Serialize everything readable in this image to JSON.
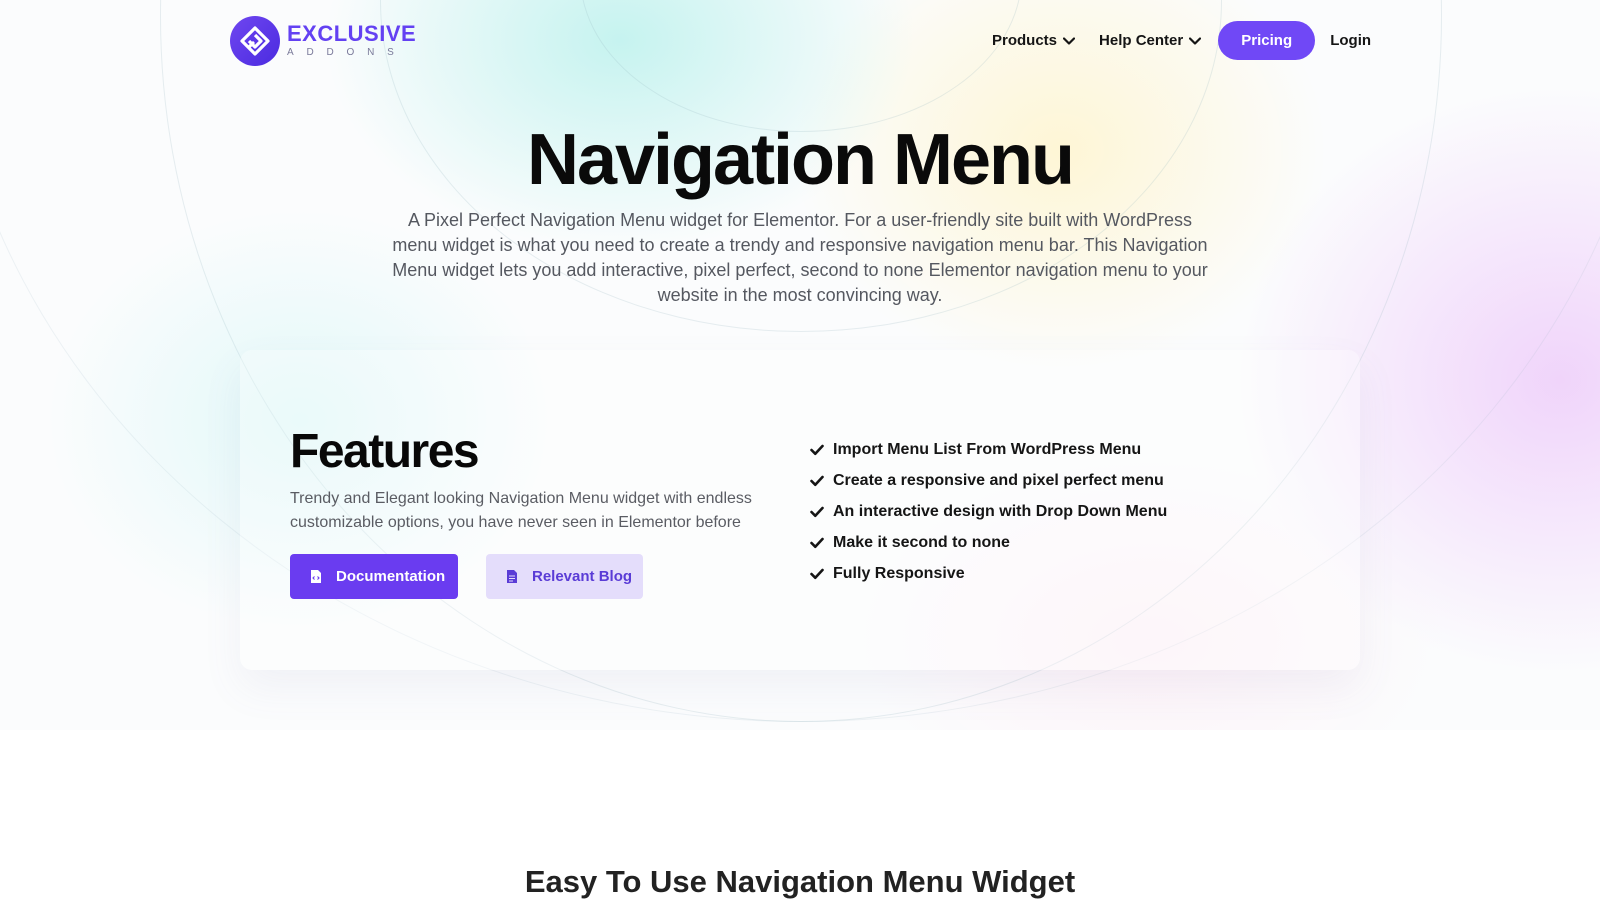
{
  "colors": {
    "brand": "#6341f2",
    "primary_button": "#6a3cf0",
    "pricing_button": "#7048f6",
    "secondary_button_bg": "#e4ddfb",
    "secondary_button_text": "#5a3cd6",
    "heading": "#0a0a0a",
    "body_text": "#555860"
  },
  "header": {
    "logo": {
      "title": "EXCLUSIVE",
      "subtitle": "ADDONS",
      "icon": "exclusive-addons-logo"
    },
    "nav": [
      {
        "label": "Products",
        "icon": "chevron-down-icon"
      },
      {
        "label": "Help Center",
        "icon": "chevron-down-icon"
      }
    ],
    "pricing_label": "Pricing",
    "login_label": "Login"
  },
  "hero": {
    "title": "Navigation Menu",
    "description": "A Pixel Perfect Navigation Menu widget for Elementor. For a user-friendly site built with WordPress menu widget is what you need to create a trendy and responsive navigation menu bar. This Navigation Menu widget lets you add interactive, pixel perfect, second to none Elementor navigation menu to your website in the most convincing way."
  },
  "features": {
    "title": "Features",
    "description": "Trendy and Elegant looking Navigation Menu widget with endless customizable options, you have never seen in Elementor before",
    "buttons": {
      "documentation": {
        "label": "Documentation",
        "icon": "code-file-icon"
      },
      "blog": {
        "label": "Relevant Blog",
        "icon": "document-icon"
      }
    },
    "list": [
      "Import Menu List From WordPress Menu",
      "Create a responsive and pixel perfect menu",
      "An interactive design with Drop Down Menu",
      "Make it second to none",
      "Fully Responsive"
    ]
  },
  "next_section": {
    "title": "Easy To Use Navigation Menu Widget"
  }
}
